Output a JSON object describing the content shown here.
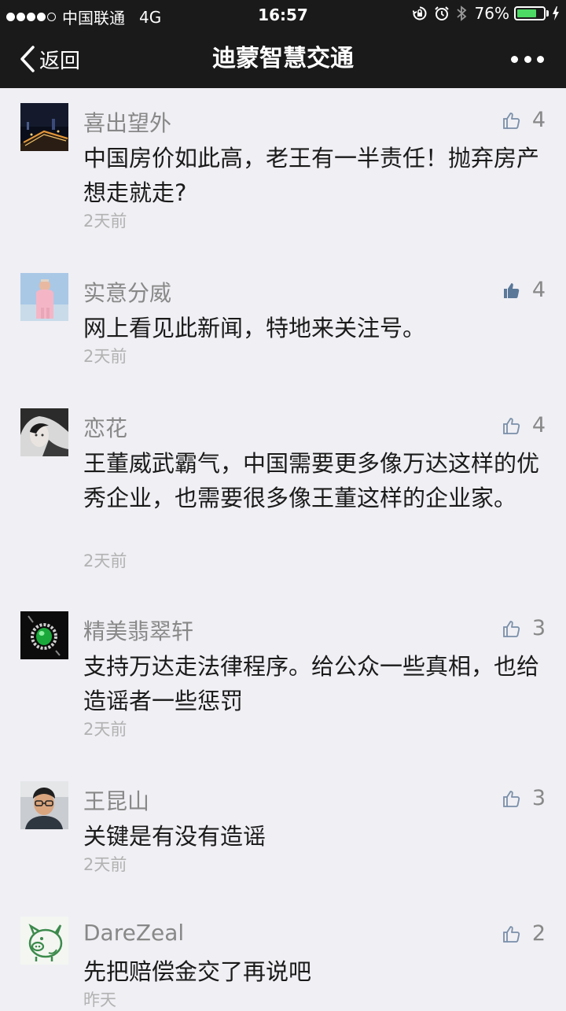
{
  "status_bar": {
    "carrier": "中国联通",
    "network": "4G",
    "time": "16:57",
    "battery": "76%",
    "battery_level": 0.76,
    "icons": [
      "signal-dots-icon",
      "orientation-lock-icon",
      "alarm-icon",
      "bluetooth-icon",
      "battery-icon",
      "charging-icon"
    ]
  },
  "nav": {
    "back_label": "返回",
    "title": "迪蒙智慧交通",
    "more_icon": "more-dots-icon"
  },
  "colors": {
    "bar_bg": "#1a1a1a",
    "page_bg": "#efeff4",
    "name_gray": "#888888",
    "time_gray": "#b2b2b2",
    "like_blue": "#7a8fa8",
    "liked_blue": "#5b7898",
    "battery_green": "#4cd964"
  },
  "comments": [
    {
      "name": "喜出望外",
      "likes": "4",
      "liked": false,
      "text": "中国房价如此高，老王有一半责任！抛弃房产想走就走?",
      "time": "2天前",
      "avatar": "night-city-avatar"
    },
    {
      "name": "实意分威",
      "likes": "4",
      "liked": true,
      "text": "网上看见此新闻，特地来关注号。",
      "time": "2天前",
      "avatar": "person-pink-avatar"
    },
    {
      "name": "恋花",
      "likes": "4",
      "liked": false,
      "text": "王董威武霸气，中国需要更多像万达这样的优秀企业，也需要很多像王董这样的企业家。",
      "time": "2天前",
      "avatar": "bw-portrait-avatar"
    },
    {
      "name": "精美翡翠轩",
      "likes": "3",
      "liked": false,
      "text": "支持万达走法律程序。给公众一些真相，也给造谣者一些惩罚",
      "time": "2天前",
      "avatar": "jade-ring-avatar"
    },
    {
      "name": "王昆山",
      "likes": "3",
      "liked": false,
      "text": "关键是有没有造谣",
      "time": "2天前",
      "avatar": "man-glasses-avatar"
    },
    {
      "name": "DareZeal",
      "likes": "2",
      "liked": false,
      "text": "先把赔偿金交了再说吧",
      "time": "昨天",
      "avatar": "pig-drawing-avatar"
    }
  ]
}
